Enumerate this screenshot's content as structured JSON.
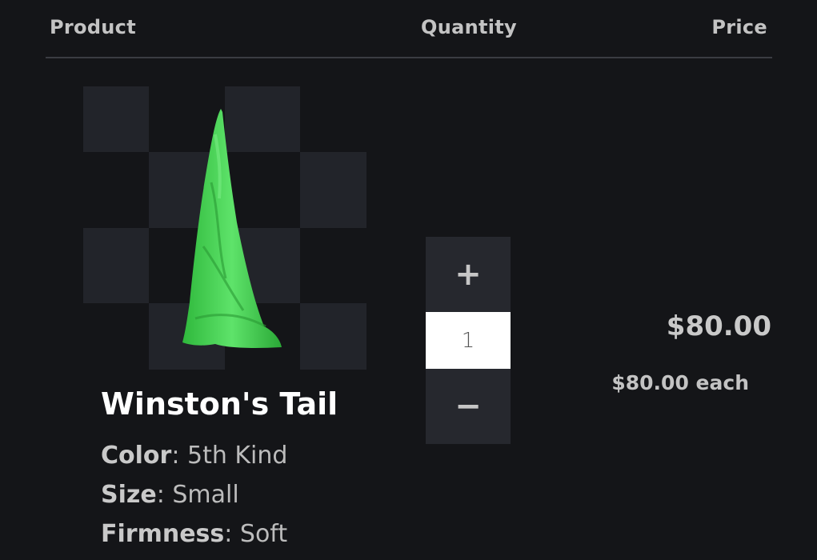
{
  "header": {
    "product_label": "Product",
    "quantity_label": "Quantity",
    "price_label": "Price"
  },
  "item": {
    "title": "Winston's Tail",
    "options": [
      {
        "name": "Color",
        "value": "5th Kind"
      },
      {
        "name": "Size",
        "value": "Small"
      },
      {
        "name": "Firmness",
        "value": "Soft"
      }
    ],
    "quantity": "1",
    "increment_symbol": "+",
    "decrement_symbol": "−",
    "price_total": "$80.00",
    "price_each": "$80.00 each"
  },
  "colors": {
    "background": "#141518",
    "checker_tile": "#22242a",
    "product_green": "#3ecf4a",
    "stepper_button": "#26282e"
  },
  "icons": {
    "increment": "plus-icon",
    "decrement": "minus-icon"
  }
}
